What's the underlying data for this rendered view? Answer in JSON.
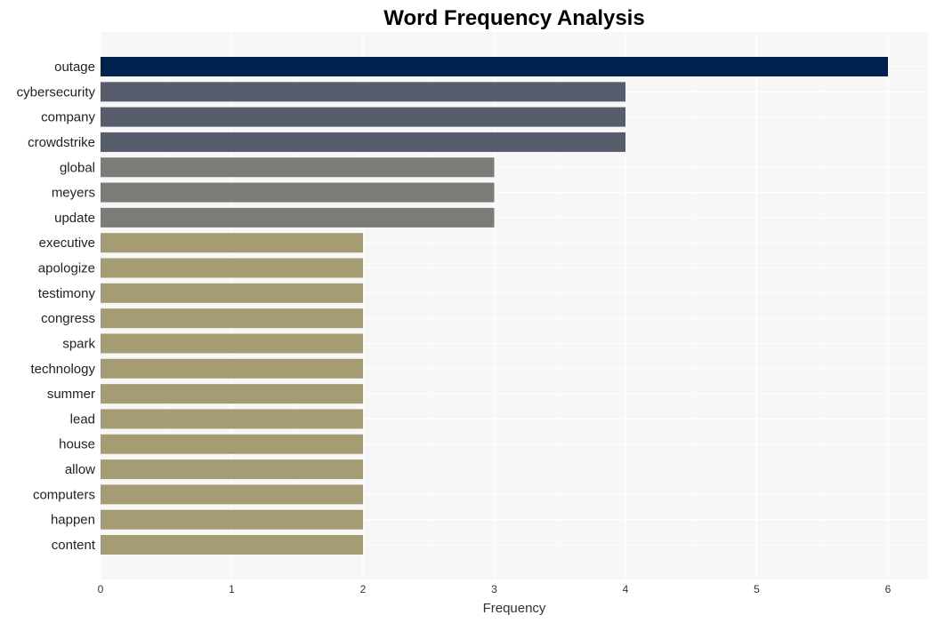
{
  "chart_data": {
    "type": "bar",
    "orientation": "horizontal",
    "title": "Word Frequency Analysis",
    "xlabel": "Frequency",
    "ylabel": "",
    "xlim": [
      0,
      6.3
    ],
    "xticks": [
      0,
      1,
      2,
      3,
      4,
      5,
      6
    ],
    "grid": true,
    "legend": "none",
    "categories": [
      "outage",
      "cybersecurity",
      "company",
      "crowdstrike",
      "global",
      "meyers",
      "update",
      "executive",
      "apologize",
      "testimony",
      "congress",
      "spark",
      "technology",
      "summer",
      "lead",
      "house",
      "allow",
      "computers",
      "happen",
      "content"
    ],
    "values": [
      6,
      4,
      4,
      4,
      3,
      3,
      3,
      2,
      2,
      2,
      2,
      2,
      2,
      2,
      2,
      2,
      2,
      2,
      2,
      2
    ],
    "colors_by_value": {
      "6": "#00224e",
      "4": "#575d6d",
      "3": "#7c7b78",
      "2": "#a59c74"
    },
    "background": "#f7f7f7",
    "gridline_color": "#ffffff"
  }
}
